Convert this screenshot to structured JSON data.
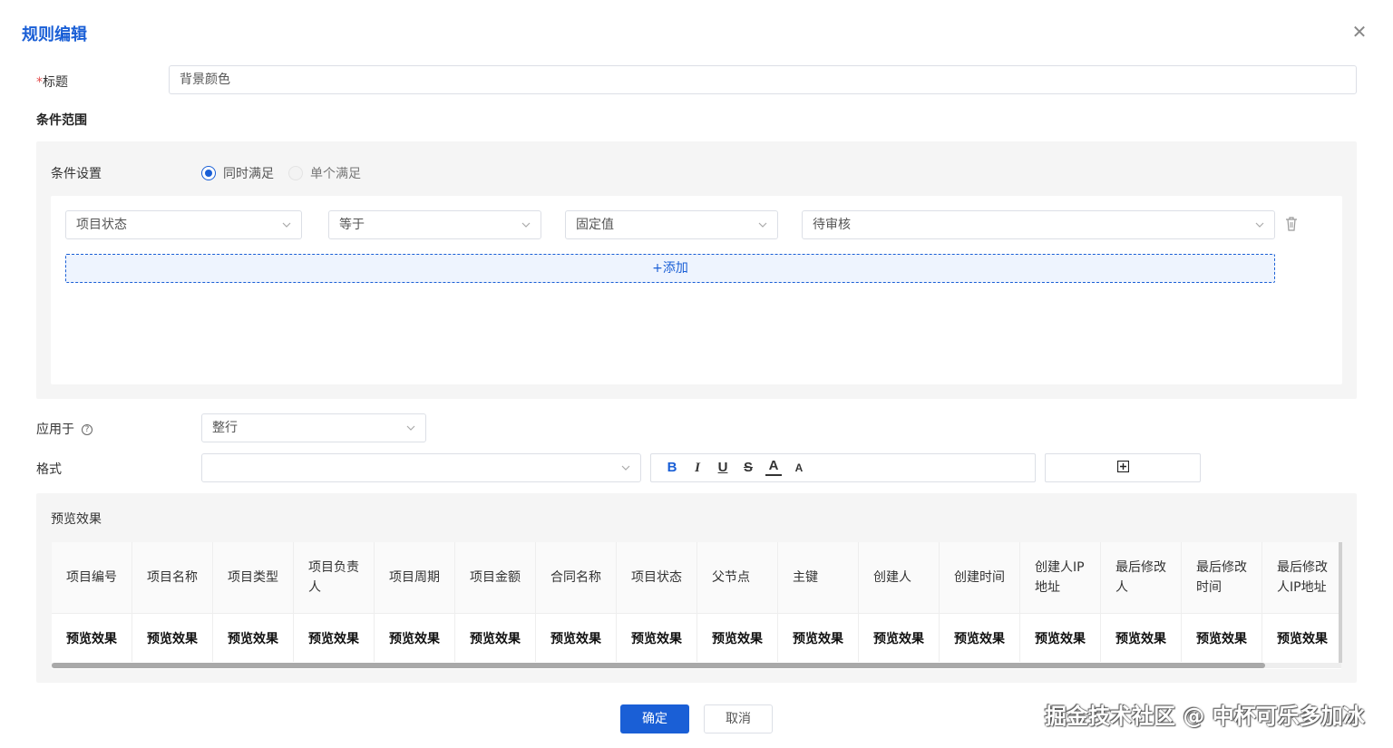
{
  "dialog": {
    "title": "规则编辑",
    "close_icon": "close-icon"
  },
  "form": {
    "title_required_mark": "*",
    "title_label": "标题",
    "title_value": "背景颜色",
    "condition_range_heading": "条件范围",
    "condition_settings_label": "条件设置",
    "match_modes": [
      {
        "label": "同时满足",
        "checked": true
      },
      {
        "label": "单个满足",
        "checked": false
      }
    ],
    "condition_row": {
      "field": "项目状态",
      "operator": "等于",
      "value_type": "固定值",
      "value": "待审核"
    },
    "add_label": "+添加",
    "apply_to_label": "应用于",
    "apply_to_value": "整行",
    "format_label": "格式",
    "format_select_value": "",
    "toolbar": {
      "bold": "B",
      "italic": "I",
      "underline": "U",
      "strike": "S",
      "font_color": "A",
      "bg_color": "A"
    }
  },
  "preview": {
    "title": "预览效果",
    "columns": [
      "项目编号",
      "项目名称",
      "项目类型",
      "项目负责人",
      "项目周期",
      "项目金额",
      "合同名称",
      "项目状态",
      "父节点",
      "主键",
      "创建人",
      "创建时间",
      "创建人IP地址",
      "最后修改人",
      "最后修改时间",
      "最后修改人IP地址"
    ],
    "row": [
      "预览效果",
      "预览效果",
      "预览效果",
      "预览效果",
      "预览效果",
      "预览效果",
      "预览效果",
      "预览效果",
      "预览效果",
      "预览效果",
      "预览效果",
      "预览效果",
      "预览效果",
      "预览效果",
      "预览效果",
      "预览效果"
    ]
  },
  "footer": {
    "confirm_label": "确定",
    "cancel_label": "取消"
  },
  "watermark": "掘金技术社区 @ 中杯可乐多加冰",
  "colors": {
    "accent": "#1a5fd6",
    "panel_bg": "#f5f5f5",
    "required": "#e34d4d"
  }
}
